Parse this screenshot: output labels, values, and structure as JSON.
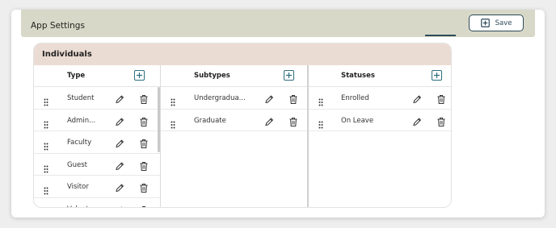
{
  "header": {
    "title": "App Settings",
    "save_label": "Save"
  },
  "panel": {
    "title": "Individuals"
  },
  "columns": {
    "type": {
      "header": "Type",
      "rows": [
        "Student",
        "Admin...",
        "Faculty",
        "Guest",
        "Visitor",
        "Volunt..."
      ]
    },
    "subtypes": {
      "header": "Subtypes",
      "rows": [
        "Undergradua...",
        "Graduate"
      ]
    },
    "statuses": {
      "header": "Statuses",
      "rows": [
        "Enrolled",
        "On Leave"
      ]
    }
  },
  "icons": {
    "grip": "drag-handle-icon",
    "edit": "pencil-icon",
    "delete": "trash-icon",
    "add": "plus-box-icon"
  },
  "colors": {
    "topbar": "#d8d8c8",
    "panel_header": "#ebdcd3",
    "accent": "#2d4a5a",
    "add_icon": "#2d6e7e"
  }
}
